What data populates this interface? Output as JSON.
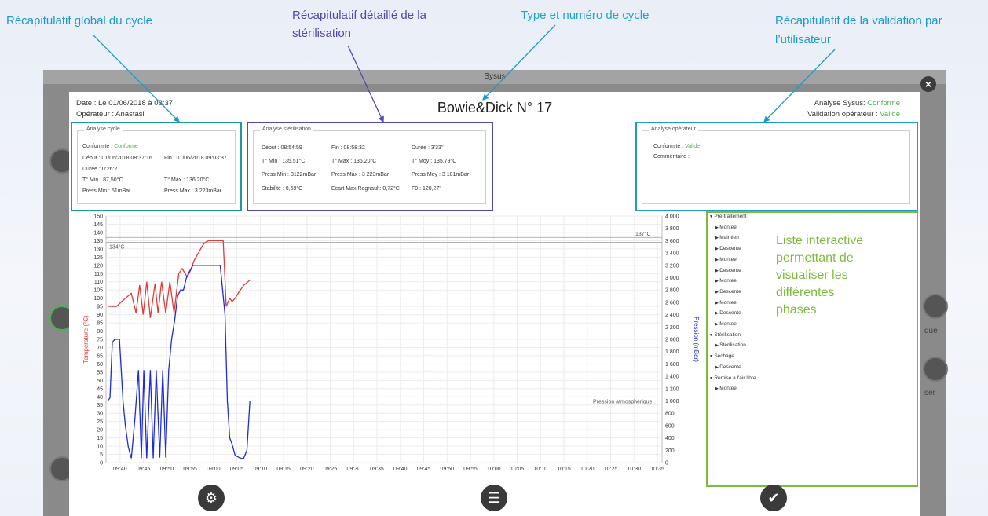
{
  "annotations": {
    "global": "Récapitulatif global du cycle",
    "detail_line1": "Récapitulatif détaillé de la",
    "detail_line2": "stérilisation",
    "type": "Type et numéro de cycle",
    "validation_line1": "Récapitulatif de la validation par",
    "validation_line2": "l’utilisateur",
    "list_lines": [
      "Liste interactive",
      "permettant de",
      "visualiser les",
      "différentes",
      "phases"
    ]
  },
  "background": {
    "window_title": "Sysus",
    "side_labels": [
      "que",
      "ser"
    ]
  },
  "header": {
    "date": "Date : Le 01/06/2018 à 08:37",
    "operator": "Opérateur : Anastasi",
    "cycle_title": "Bowie&Dick  N° 17",
    "analyse_sysus_label": "Analyse Sysus:",
    "analyse_sysus_value": "Conforme",
    "validation_label": "Validation opérateur :",
    "validation_value": "Valide",
    "close": "×"
  },
  "cycle_panel": {
    "title": "Analyse cycle",
    "conformite_label": "Conformité :",
    "conformite_value": "Conforme",
    "debut": "Début : 01/06/2018 08:37:16",
    "fin": "Fin : 01/06/2018 09:03:37",
    "duree": "Durée :  0:26:21",
    "tmin": "T° Min : 87,50°C",
    "tmax": "T° Max : 136,20°C",
    "pmin": "Press Min : 51mBar",
    "pmax": "Press Max : 3 223mBar"
  },
  "steril_panel": {
    "title": "Analyse stérilisation",
    "debut": "Début : 08:54:59",
    "fin": "Fin : 08:58:32",
    "duree": "Durée : 3'33''",
    "tmin": "T° Min :  135,51°C",
    "tmax": "T° Max :  136,20°C",
    "tmoy": "T° Moy :  135,79°C",
    "pmin": "Press Min : 3122mBar",
    "pmax": "Press Max : 3 223mBar",
    "pmoy": "Press Moy : 3 181mBar",
    "stab": "Stabilité :  0,69°C",
    "ecart": "Ecart Max Regnault:  0,72°C",
    "f0": "F0 : 120,27'"
  },
  "operator_panel": {
    "title": "Analyse opérateur",
    "conformite_label": "Conformité",
    "conformite_value": ": Valide",
    "commentaire": "Commentaire :"
  },
  "chart_data": {
    "type": "line",
    "ylabel_left": "Temperature (°C)",
    "ylabel_right": "Pression (mBar)",
    "yticks_left": [
      150,
      145,
      140,
      135,
      130,
      125,
      120,
      115,
      110,
      105,
      100,
      95,
      90,
      85,
      80,
      75,
      70,
      65,
      60,
      55,
      50,
      45,
      40,
      35,
      30,
      25,
      20,
      15,
      10,
      5,
      0
    ],
    "yticks_right": [
      "4 000",
      "3 800",
      "3 600",
      "3 400",
      "3 200",
      "3 000",
      "2 800",
      "2 600",
      "2 400",
      "2 200",
      "2 000",
      "1 800",
      "1 600",
      "1 400",
      "1 200",
      "1 000",
      "800",
      "600",
      "400",
      "200",
      "0"
    ],
    "xticks": [
      "09:40",
      "09:45",
      "09:50",
      "09:55",
      "09:00",
      "09:05",
      "09:10",
      "09:15",
      "09:20",
      "09:25",
      "09:30",
      "09:35",
      "09:40",
      "09:45",
      "09:50",
      "09:55",
      "10:00",
      "10:05",
      "10:10",
      "10:15",
      "10:20",
      "10:25",
      "10:30",
      "10:35"
    ],
    "ylim_left": [
      0,
      150
    ],
    "ylim_right": [
      0,
      4000
    ],
    "grid": true,
    "reference_lines": [
      {
        "label": "134°C",
        "value": 134
      },
      {
        "label": "137°C",
        "value": 137
      },
      {
        "label": "Pression atmosphérique",
        "value": 1000
      }
    ],
    "series": [
      {
        "name": "Temperature (°C)",
        "color": "#e53935",
        "axis": "left",
        "x": [
          0,
          1.5,
          3,
          4,
          4.8,
          5.4,
          6,
          6.6,
          7.2,
          8,
          8.5,
          9.1,
          9.8,
          10.5,
          11.2,
          12,
          12.6,
          13.4,
          14,
          14.6,
          15.4,
          16,
          16.5,
          17,
          17.5,
          18,
          18.8,
          19.5,
          20,
          20.6,
          21,
          21.5,
          22.2,
          23,
          24
        ],
        "y": [
          95,
          95,
          100,
          103,
          91,
          108,
          90,
          110,
          88,
          109,
          91,
          110,
          91,
          110,
          91,
          115,
          118,
          113,
          117,
          123,
          128,
          132,
          134,
          135,
          135,
          135,
          135,
          135,
          95,
          100,
          98,
          100,
          104,
          108,
          111
        ]
      },
      {
        "name": "Pression (mBar)",
        "color": "#1e2bd6",
        "axis": "right",
        "x": [
          0,
          0.4,
          0.8,
          1.2,
          2,
          2.6,
          3,
          3.5,
          4,
          4.6,
          5.2,
          5.7,
          6.1,
          6.6,
          7.2,
          7.7,
          8.2,
          8.8,
          9.3,
          9.8,
          10.3,
          10.8,
          11.3,
          11.8,
          12.3,
          12.8,
          13.3,
          13.8,
          14.4,
          15,
          15.6,
          16.1,
          16.6,
          17.2,
          17.8,
          18.4,
          19,
          19.8,
          20.2,
          20.6,
          21,
          21.5,
          22.2,
          22.9,
          23.5,
          24
        ],
        "y": [
          1000,
          1050,
          1950,
          2000,
          2000,
          1000,
          600,
          250,
          70,
          700,
          1500,
          70,
          1500,
          70,
          1500,
          70,
          1500,
          80,
          1500,
          80,
          1500,
          2000,
          2300,
          2700,
          2800,
          2800,
          3000,
          3100,
          3200,
          3200,
          3200,
          3200,
          3200,
          3200,
          3200,
          3200,
          3200,
          2400,
          1000,
          400,
          300,
          120,
          80,
          60,
          200,
          1000
        ]
      }
    ]
  },
  "tree": {
    "items": [
      {
        "label": "Pré-traitement",
        "level": 0,
        "open": true
      },
      {
        "label": "Montee",
        "level": 1
      },
      {
        "label": "Maintien",
        "level": 1
      },
      {
        "label": "Descente",
        "level": 1
      },
      {
        "label": "Montee",
        "level": 1
      },
      {
        "label": "Descente",
        "level": 1
      },
      {
        "label": "Montee",
        "level": 1
      },
      {
        "label": "Descente",
        "level": 1
      },
      {
        "label": "Montee",
        "level": 1
      },
      {
        "label": "Descente",
        "level": 1
      },
      {
        "label": "Montee",
        "level": 1
      },
      {
        "label": "Stérilisation",
        "level": 0,
        "open": true
      },
      {
        "label": "Stérilisation",
        "level": 1
      },
      {
        "label": "Séchage",
        "level": 0,
        "open": true
      },
      {
        "label": "Descente",
        "level": 1
      },
      {
        "label": "Remise à l'air libre",
        "level": 0,
        "open": true
      },
      {
        "label": "Montee",
        "level": 1
      }
    ]
  },
  "bottom_buttons": {
    "settings": "gear-icon",
    "list": "list-icon",
    "validate": "check-icon"
  },
  "colors": {
    "annotation_cyan": "#1e9ac9",
    "annotation_indigo": "#4e4ab0",
    "annotation_green": "#7dbb3f",
    "ok_green": "#4caf50",
    "temperature": "#e53935",
    "pressure": "#1e2bd6"
  }
}
